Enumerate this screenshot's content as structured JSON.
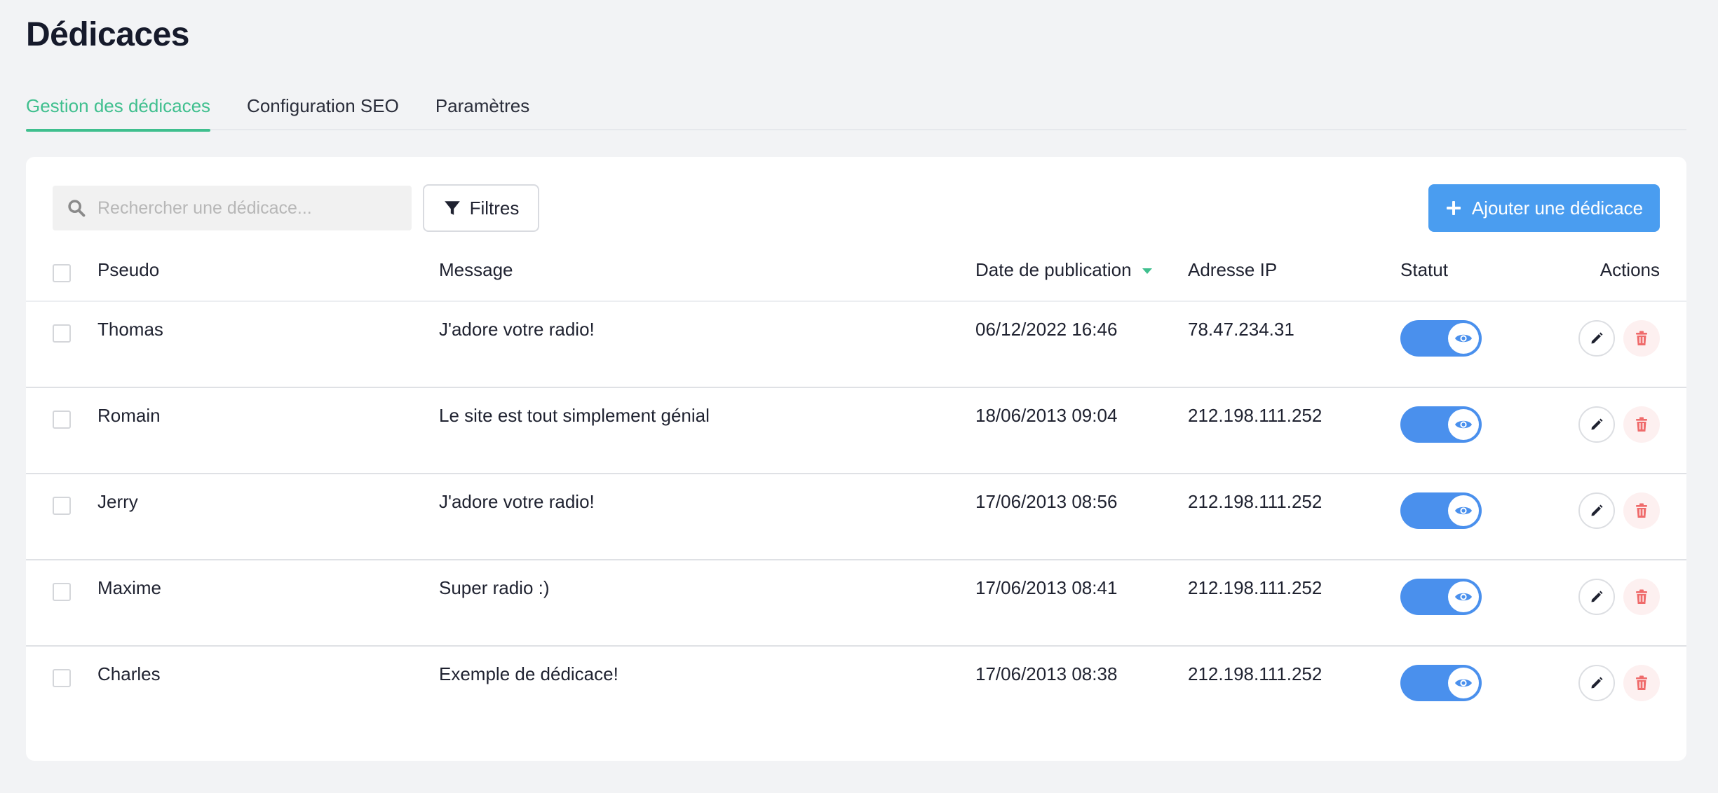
{
  "page": {
    "title": "Dédicaces"
  },
  "tabs": [
    {
      "label": "Gestion des dédicaces",
      "active": true
    },
    {
      "label": "Configuration SEO",
      "active": false
    },
    {
      "label": "Paramètres",
      "active": false
    }
  ],
  "toolbar": {
    "search_placeholder": "Rechercher une dédicace...",
    "search_value": "",
    "filter_label": "Filtres",
    "add_label": "Ajouter une dédicace"
  },
  "table": {
    "columns": {
      "pseudo": "Pseudo",
      "message": "Message",
      "date": "Date de publication",
      "ip": "Adresse IP",
      "status": "Statut",
      "actions": "Actions"
    },
    "sort": {
      "column": "date",
      "direction": "desc"
    },
    "rows": [
      {
        "pseudo": "Thomas",
        "message": "J'adore votre radio!",
        "date": "06/12/2022 16:46",
        "ip": "78.47.234.31",
        "visible": true
      },
      {
        "pseudo": "Romain",
        "message": "Le site est tout simplement génial",
        "date": "18/06/2013 09:04",
        "ip": "212.198.111.252",
        "visible": true
      },
      {
        "pseudo": "Jerry",
        "message": "J'adore votre radio!",
        "date": "17/06/2013 08:56",
        "ip": "212.198.111.252",
        "visible": true
      },
      {
        "pseudo": "Maxime",
        "message": "Super radio :)",
        "date": "17/06/2013 08:41",
        "ip": "212.198.111.252",
        "visible": true
      },
      {
        "pseudo": "Charles",
        "message": "Exemple de dédicace!",
        "date": "17/06/2013 08:38",
        "ip": "212.198.111.252",
        "visible": true
      }
    ]
  },
  "colors": {
    "accent_green": "#3fbf8e",
    "primary_blue": "#4a9df0",
    "toggle_blue": "#4a90ed",
    "delete_red": "#ef6b6b"
  },
  "icons": {
    "search": "search-icon",
    "filter": "filter-icon",
    "add": "plus-icon",
    "sort": "sort-down-icon",
    "status": "eye-icon",
    "edit": "pencil-icon",
    "delete": "trash-icon"
  }
}
